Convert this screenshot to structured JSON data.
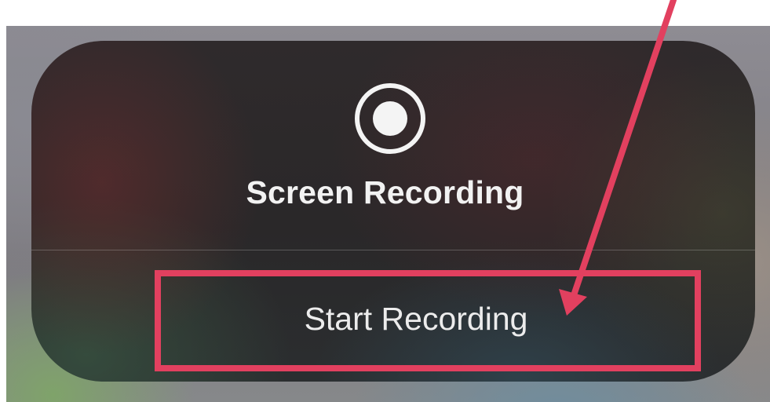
{
  "panel": {
    "title": "Screen Recording",
    "action_label": "Start Recording",
    "icon": "record-icon"
  },
  "annotation": {
    "highlight_color": "#e2405f",
    "arrow_color": "#e2405f"
  }
}
